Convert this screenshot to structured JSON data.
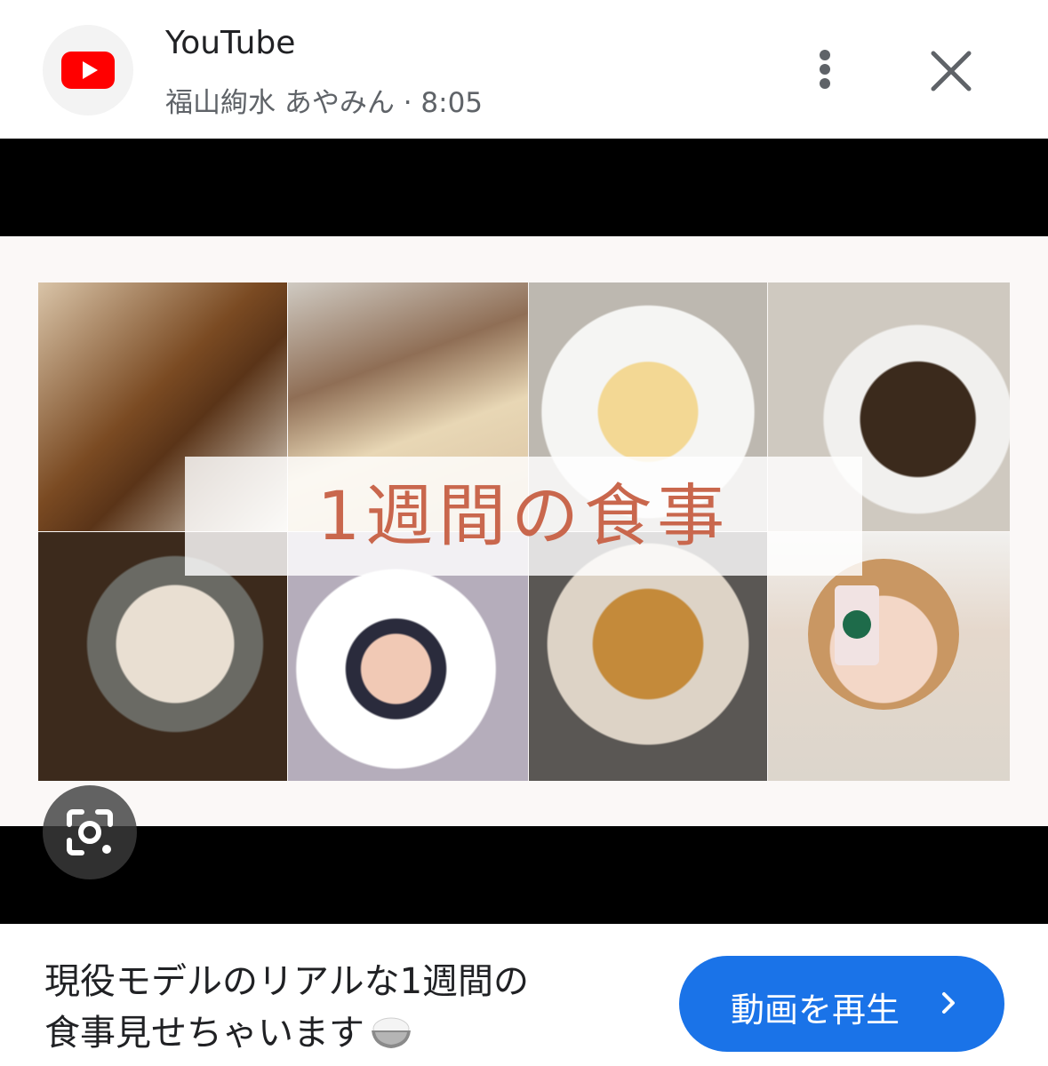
{
  "header": {
    "app_title": "YouTube",
    "subtitle": "福山絢水 あやみん · 8:05",
    "app_icon": "youtube-logo-icon",
    "menu_icon": "more-vert-icon",
    "close_icon": "close-icon"
  },
  "video": {
    "overlay_title": "1週間の食事",
    "lens_icon": "google-lens-icon"
  },
  "footer": {
    "description_line1": "現役モデルのリアルな1週間の",
    "description_line2": "食事見せちゃいます",
    "description_emoji": "rice-bowl-icon",
    "play_button_label": "動画を再生",
    "play_button_icon": "chevron-right-icon"
  },
  "colors": {
    "brand_red": "#ff0000",
    "accent_blue": "#1a73e8",
    "title_orange": "#c9674d"
  }
}
